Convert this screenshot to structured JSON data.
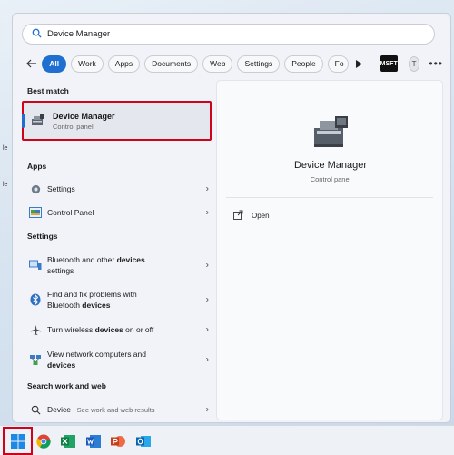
{
  "search": {
    "value": "Device Manager",
    "icon": "search-icon"
  },
  "filters": {
    "items": [
      "All",
      "Work",
      "Apps",
      "Documents",
      "Web",
      "Settings",
      "People",
      "Fo"
    ],
    "active_index": 0,
    "badge": "MSFT",
    "avatar_initial": "T",
    "more": "•••"
  },
  "sections": {
    "best_match": "Best match",
    "apps": "Apps",
    "settings": "Settings",
    "search_web": "Search work and web"
  },
  "best_match": {
    "title": "Device Manager",
    "subtitle": "Control panel"
  },
  "apps": [
    {
      "label": "Settings",
      "icon": "gear-icon"
    },
    {
      "label": "Control Panel",
      "icon": "control-panel-icon"
    }
  ],
  "settings_results": [
    {
      "line1_pre": "Bluetooth and other ",
      "line1_hl": "devices",
      "line2_pre": "settings",
      "line2_hl": "",
      "icon": "bluetooth-devices-icon"
    },
    {
      "line1_pre": "Find and fix problems with",
      "line1_hl": "",
      "line2_pre": "Bluetooth ",
      "line2_hl": "devices",
      "icon": "bluetooth-icon"
    },
    {
      "line1_pre": "Turn wireless ",
      "line1_hl": "devices",
      "line1_post": " on or off",
      "icon": "airplane-icon"
    },
    {
      "line1_pre": "View network computers and",
      "line1_hl": "",
      "line2_pre": "",
      "line2_hl": "devices",
      "icon": "network-icon"
    }
  ],
  "web_result": {
    "term": "Device",
    "suffix": " - See work and web results"
  },
  "detail": {
    "title": "Device Manager",
    "subtitle": "Control panel",
    "action": "Open"
  },
  "colors": {
    "accent": "#1f6fd1",
    "highlight_box": "#d0021b"
  },
  "left_edge_text": [
    "le",
    "le"
  ]
}
